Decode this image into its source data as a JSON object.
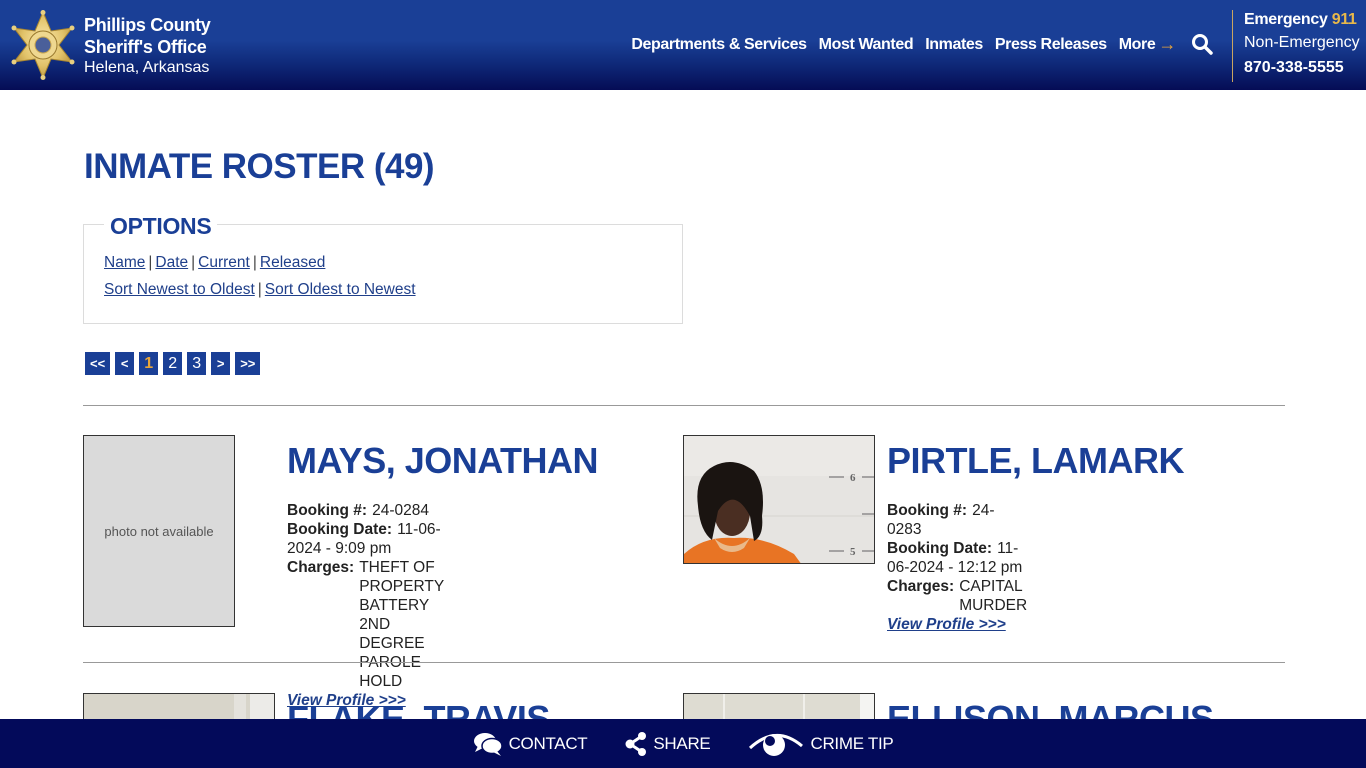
{
  "header": {
    "org_line1": "Phillips County",
    "org_line2": "Sheriff's Office",
    "location": "Helena, Arkansas",
    "nav": [
      {
        "label": "Departments & Services"
      },
      {
        "label": "Most Wanted"
      },
      {
        "label": "Inmates"
      },
      {
        "label": "Press Releases"
      },
      {
        "label": "More"
      }
    ],
    "more_arrow": "→",
    "emergency_label": "Emergency",
    "emergency_number": "911",
    "non_emergency_label": "Non-Emergency",
    "non_emergency_number": "870-338-5555"
  },
  "page": {
    "title": "INMATE ROSTER (49)"
  },
  "options": {
    "legend": "OPTIONS",
    "filters": [
      "Name",
      "Date",
      "Current",
      "Released"
    ],
    "sorts": [
      "Sort Newest to Oldest",
      "Sort Oldest to Newest"
    ],
    "separator": "|"
  },
  "pagination": {
    "first": "<<",
    "prev": "<",
    "pages": [
      "1",
      "2",
      "3"
    ],
    "current": "1",
    "next": ">",
    "last": ">>"
  },
  "labels": {
    "booking_number": "Booking #:",
    "booking_date": "Booking Date:",
    "charges": "Charges:",
    "view_profile": "View Profile >>>",
    "photo_not_available": "photo not available"
  },
  "inmates": [
    {
      "name": "MAYS, JONATHAN",
      "booking_number": "24-0284",
      "booking_date": "11-06-2024 - 9:09 pm",
      "charges": [
        "THEFT OF PROPERTY",
        "BATTERY 2ND DEGREE",
        "PAROLE HOLD"
      ],
      "has_photo": false
    },
    {
      "name": "PIRTLE, LAMARK",
      "booking_number": "24-0283",
      "booking_date": "11-06-2024 - 12:12 pm",
      "charges": [
        "CAPITAL MURDER"
      ],
      "has_photo": true
    },
    {
      "name": "FLAKE, TRAVIS",
      "has_photo": true
    },
    {
      "name": "ELLISON, MARCUS",
      "has_photo": true
    }
  ],
  "footer": {
    "contact": "CONTACT",
    "share": "SHARE",
    "crime_tip": "CRIME TIP"
  },
  "colors": {
    "brand_blue": "#1a3f96",
    "accent_gold": "#e8a53a",
    "footer_navy": "#030a5a"
  }
}
